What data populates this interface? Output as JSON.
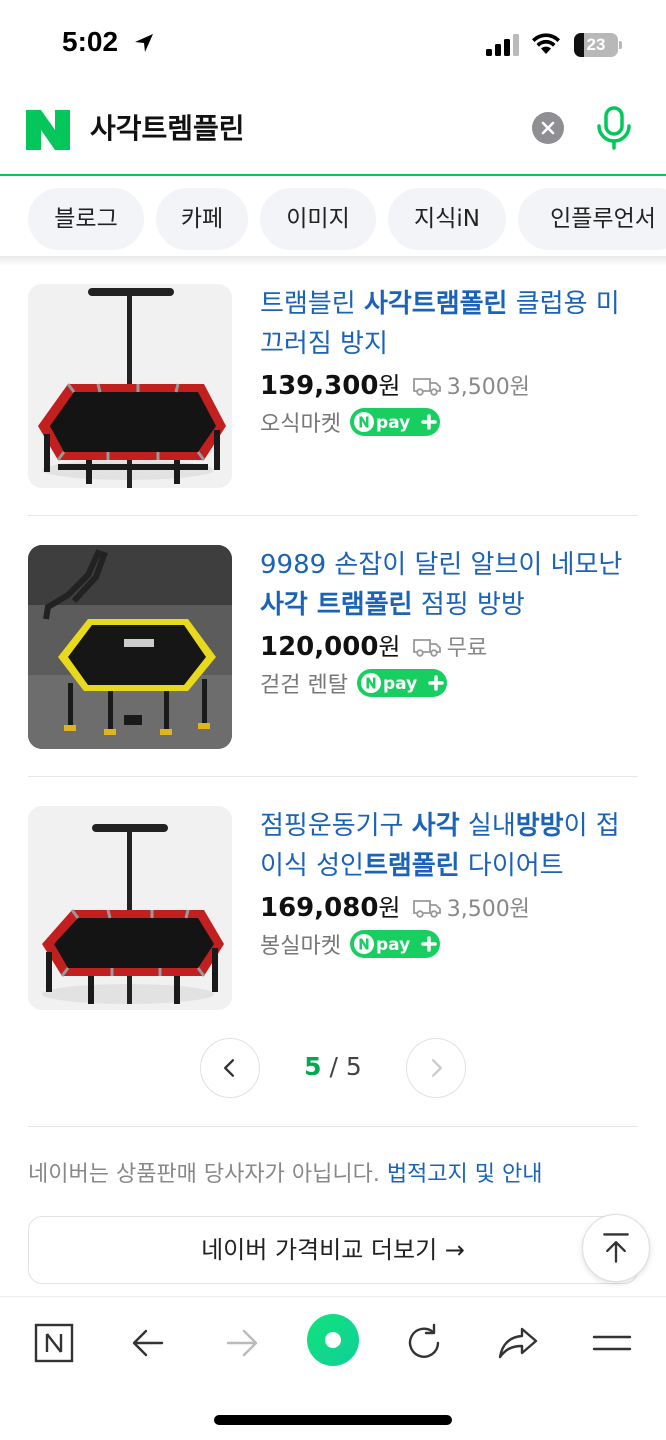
{
  "status_bar": {
    "time": "5:02",
    "battery": "23",
    "battery_level": 0.23
  },
  "search": {
    "query": "사각트렘플린"
  },
  "tabs": [
    {
      "label": "블로그"
    },
    {
      "label": "카페"
    },
    {
      "label": "이미지"
    },
    {
      "label": "지식iN"
    },
    {
      "label": "인플루언서"
    }
  ],
  "products": [
    {
      "title_parts": [
        {
          "text": "트램블린 ",
          "bold": false
        },
        {
          "text": "사각트램폴린",
          "bold": true
        },
        {
          "text": " 클럽용 미끄러짐 방지",
          "bold": false
        }
      ],
      "price": "139,300",
      "price_unit": "원",
      "shipping": "3,500원",
      "seller": "오식마켓"
    },
    {
      "title_parts": [
        {
          "text": "9989 손잡이 달린 알브이 네모난 ",
          "bold": false
        },
        {
          "text": "사각 트램폴린",
          "bold": true
        },
        {
          "text": " 점핑 방방",
          "bold": false
        }
      ],
      "price": "120,000",
      "price_unit": "원",
      "shipping": "무료",
      "seller": "걷걷 렌탈"
    },
    {
      "title_parts": [
        {
          "text": "점핑운동기구 ",
          "bold": false
        },
        {
          "text": "사각",
          "bold": true
        },
        {
          "text": " 실내",
          "bold": false
        },
        {
          "text": "방방",
          "bold": true
        },
        {
          "text": "이 접이식 성인",
          "bold": false
        },
        {
          "text": "트램폴린",
          "bold": true
        },
        {
          "text": " 다이어트",
          "bold": false
        }
      ],
      "price": "169,080",
      "price_unit": "원",
      "shipping": "3,500원",
      "seller": "봉실마켓"
    }
  ],
  "npay_label": "pay",
  "pagination": {
    "current": "5",
    "separator": "/",
    "total": "5"
  },
  "notice": {
    "text": "네이버는 상품판매 당사자가 아닙니다. ",
    "link": "법적고지 및 안내"
  },
  "more_button": {
    "label": "네이버 가격비교 더보기 →"
  },
  "colors": {
    "naver_green": "#03c75a",
    "link_blue": "#1b63b8",
    "npay_green": "#19ce60"
  },
  "bottom_bar": [
    "naver-home-icon",
    "back-arrow-icon",
    "forward-arrow-icon",
    "green-dot-icon",
    "refresh-icon",
    "share-icon",
    "menu-icon"
  ]
}
